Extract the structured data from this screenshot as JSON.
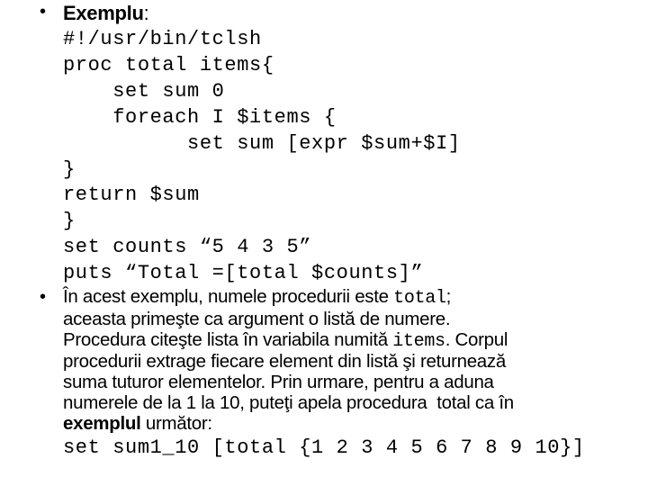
{
  "bullet1": {
    "heading_bold": "Exemplu",
    "heading_suffix": ":",
    "code_lines": [
      "#!/usr/bin/tclsh",
      "proc total items{",
      "    set sum 0",
      "    foreach I $items {",
      "          set sum [expr $sum+$I]",
      "}",
      "return $sum",
      "}",
      "set counts “5 4 3 5”",
      "puts “Total =[total $counts]”"
    ]
  },
  "bullet2": {
    "line1_text": "În acest exemplu, numele procedurii este ",
    "line1_code": "total",
    "line1_end": ";",
    "line2": "aceasta primeşte ca argument o listă de numere.",
    "line3_text": "Procedura citeşte lista în variabila numită ",
    "line3_code": "items",
    "line3_end": ". Corpul",
    "line4": "procedurii extrage fiecare element din listă şi returnează",
    "line5": "suma tuturor elementelor. Prin urmare, pentru a aduna",
    "line6": "numerele de la 1 la 10, puteţi apela procedura  total ca în",
    "line7_bold": "exemplul",
    "line7_rest": " următor:",
    "code": "set sum1_10 [total {1 2 3 4 5 6 7 8 9 10}]"
  },
  "bullet_glyph": "•"
}
